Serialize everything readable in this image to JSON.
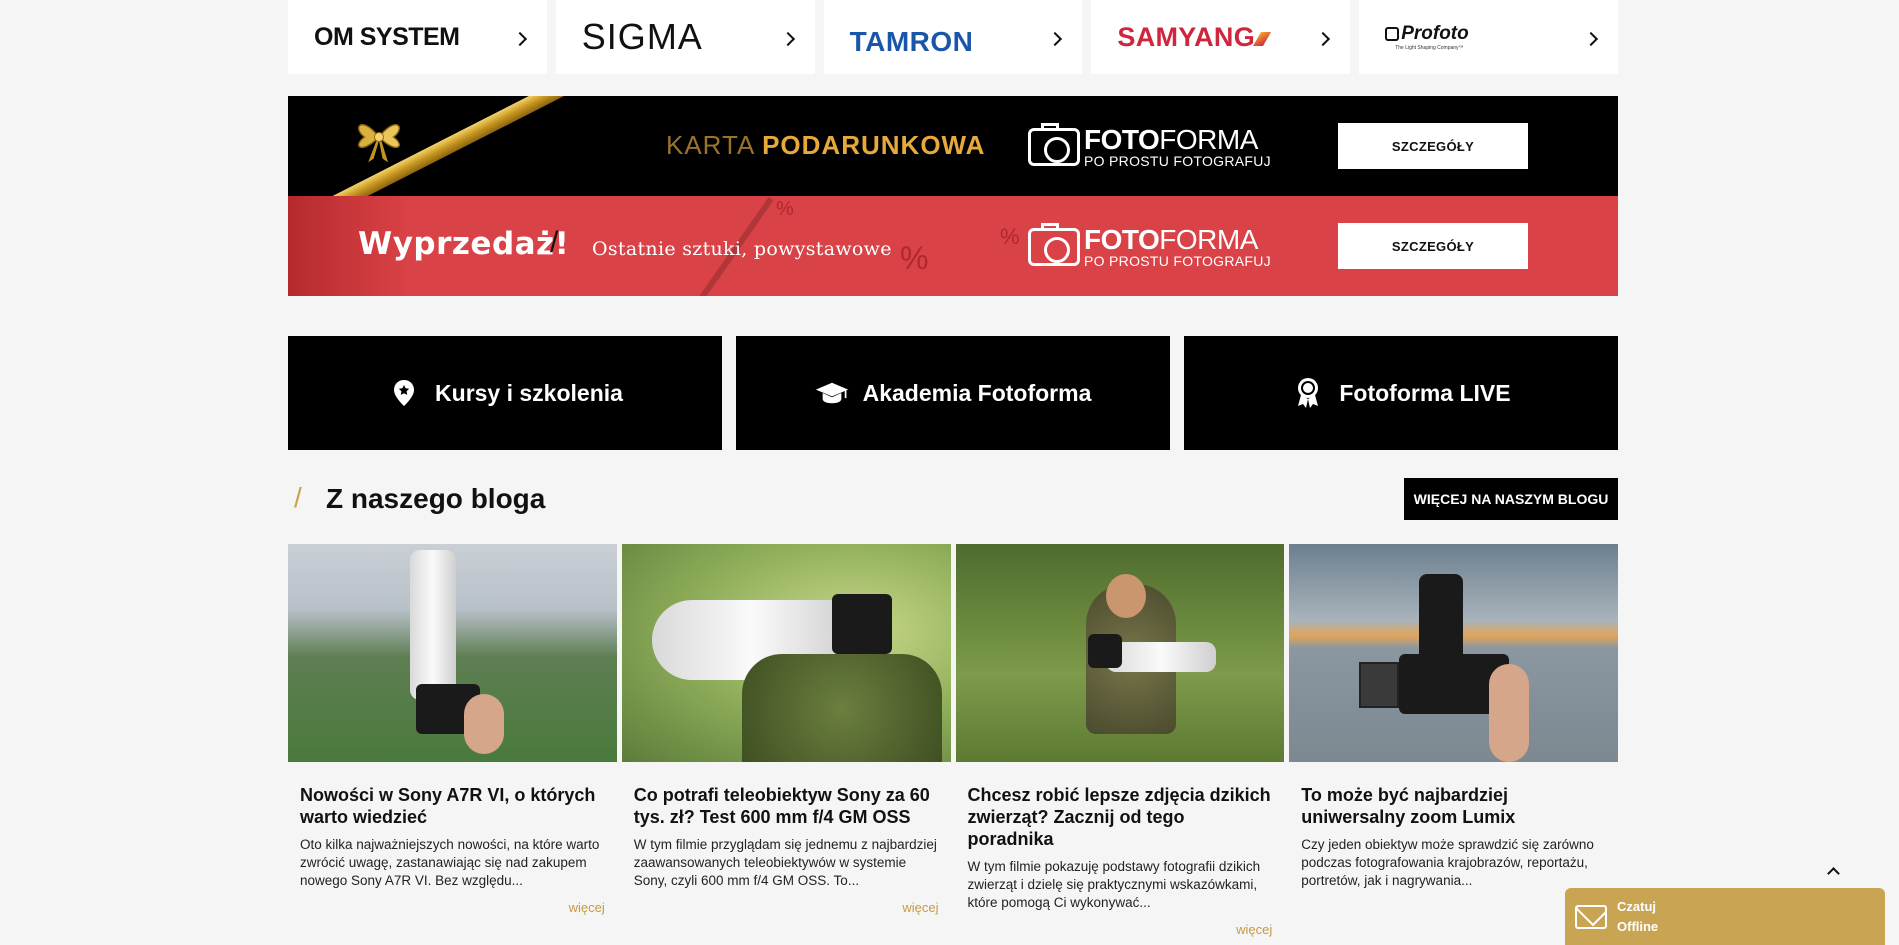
{
  "brands": [
    {
      "name": "OM SYSTEM"
    },
    {
      "name": "SIGMA"
    },
    {
      "name": "TAMRON"
    },
    {
      "name": "SAMYANG"
    },
    {
      "name": "Profoto",
      "tagline": "The Light Shaping Company™"
    }
  ],
  "gift_banner": {
    "karta_word1": "KARTA",
    "karta_word2": "PODARUNKOWA",
    "logo_bold": "FOTO",
    "logo_light": "FORMA",
    "logo_tagline": "PO PROSTU FOTOGRAFUJ",
    "button": "SZCZEGÓŁY"
  },
  "sale_banner": {
    "title": "Wyprzedaż!",
    "separator": "/",
    "subtitle": "Ostatnie sztuki, powystawowe",
    "logo_bold": "FOTO",
    "logo_light": "FORMA",
    "logo_tagline": "PO PROSTU FOTOGRAFUJ",
    "button": "SZCZEGÓŁY",
    "decor_percent": "%"
  },
  "tiles": [
    {
      "label": "Kursy i szkolenia",
      "icon": "map-pin-star-icon"
    },
    {
      "label": "Akademia Fotoforma",
      "icon": "graduation-cap-icon"
    },
    {
      "label": "Fotoforma LIVE",
      "icon": "award-badge-icon"
    }
  ],
  "blog": {
    "slash": "/",
    "title": "Z naszego bloga",
    "more_button": "WIĘCEJ NA NASZYM BLOGU",
    "posts": [
      {
        "title": "Nowości w Sony A7R VI, o których warto wiedzieć",
        "excerpt": "Oto kilka najważniejszych nowości, na które warto zwrócić uwagę, zastanawiając się nad zakupem nowego Sony A7R VI. Bez względu...",
        "more": "więcej"
      },
      {
        "title": "Co potrafi teleobiektyw Sony za 60 tys. zł? Test 600 mm f/4 GM OSS",
        "excerpt": "W tym filmie przyglądam się jednemu z najbardziej zaawansowanych teleobiektywów w systemie Sony, czyli 600 mm f/4 GM OSS. To...",
        "more": "więcej"
      },
      {
        "title": "Chcesz robić lepsze zdjęcia dzikich zwierząt? Zacznij od tego poradnika",
        "excerpt": "W tym filmie pokazuję podstawy fotografii dzikich zwierząt i dzielę się praktycznymi wskazówkami, które pomogą Ci wykonywać...",
        "more": "więcej"
      },
      {
        "title": "To może być najbardziej uniwersalny zoom Lumix",
        "excerpt": "Czy jeden obiektyw może sprawdzić się zarówno podczas fotografowania krajobrazów, reportażu, portretów, jak i nagrywania...",
        "more": "więcej"
      }
    ]
  },
  "chat": {
    "line1": "Czatuj",
    "line2": "Offline",
    "color": "#c9a553"
  },
  "colors": {
    "accent_gold": "#c9a24a",
    "sale_red": "#d94246",
    "tamron_blue": "#1a56a8",
    "samyang_red": "#d0263d"
  }
}
